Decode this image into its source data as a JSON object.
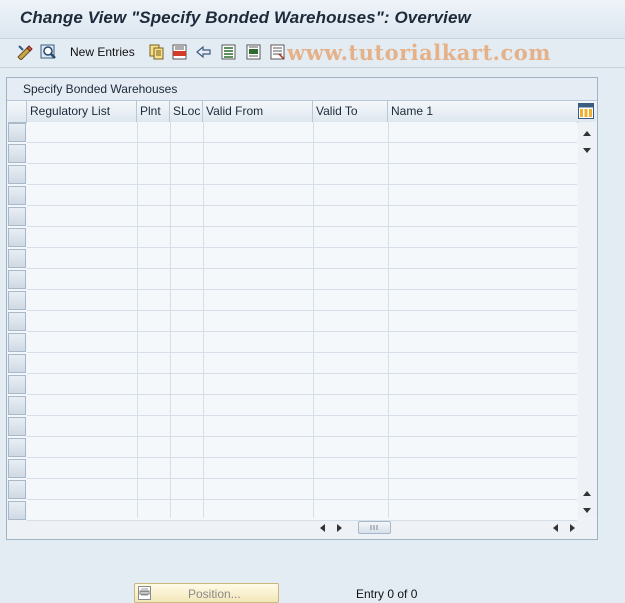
{
  "window": {
    "title": "Change View \"Specify Bonded Warehouses\": Overview"
  },
  "toolbar": {
    "items": [
      {
        "name": "display-change-icon"
      },
      {
        "name": "find-icon"
      },
      {
        "name": "copy-as-icon"
      },
      {
        "name": "delete-icon"
      },
      {
        "name": "undo-change-icon"
      },
      {
        "name": "select-all-icon"
      },
      {
        "name": "select-block-icon"
      },
      {
        "name": "deselect-all-icon"
      }
    ],
    "new_entries_label": "New Entries"
  },
  "watermark": "www.tutorialkart.com",
  "panel": {
    "title": "Specify Bonded Warehouses",
    "columns": [
      "Regulatory List",
      "Plnt",
      "SLoc",
      "Valid From",
      "Valid To",
      "Name 1"
    ],
    "row_count": 19
  },
  "footer": {
    "position_label": "Position...",
    "entry_text": "Entry 0 of 0"
  }
}
